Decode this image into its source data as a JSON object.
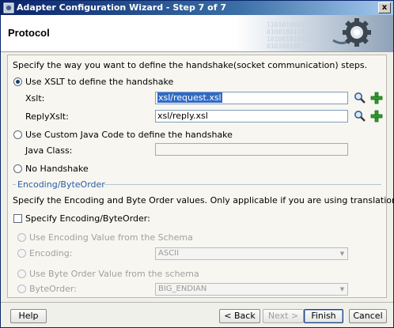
{
  "window": {
    "title": "Adapter Configuration Wizard - Step 7 of 7",
    "close_label": "x"
  },
  "header": {
    "title": "Protocol",
    "binary": [
      "110101001011",
      "0100100110101",
      "101001010011",
      "0101001001"
    ]
  },
  "content": {
    "intro": "Specify the way you want to define the handshake(socket communication) steps.",
    "xslt_option": "Use XSLT to define the handshake",
    "xslt_label": "Xslt:",
    "xslt_value": "xsl/request.xsl",
    "reply_label": "ReplyXslt:",
    "reply_value": "xsl/reply.xsl",
    "java_option": "Use Custom Java Code to define the handshake",
    "java_label": "Java Class:",
    "java_value": "",
    "none_option": "No Handshake",
    "encoding_section": "Encoding/ByteOrder",
    "encoding_intro": "Specify the Encoding and Byte Order values. Only applicable if you are using translation.",
    "specify_checkbox": "Specify Encoding/ByteOrder:",
    "encoding_schema_option": "Use Encoding Value from the Schema",
    "encoding_option": "Encoding:",
    "encoding_value": "ASCII",
    "byteorder_schema_option": "Use Byte Order Value from the schema",
    "byteorder_option": "ByteOrder:",
    "byteorder_value": "BIG_ENDIAN"
  },
  "icons": {
    "search": "magnifier-icon",
    "add": "green-plus-icon"
  },
  "buttons": {
    "help": "Help",
    "back": "< Back",
    "next": "Next >",
    "finish": "Finish",
    "cancel": "Cancel"
  },
  "colors": {
    "title_bar": "#0a246a",
    "section_label": "#2b5ea8",
    "selection": "#316ac5",
    "add_icon": "#2e9b2e"
  }
}
